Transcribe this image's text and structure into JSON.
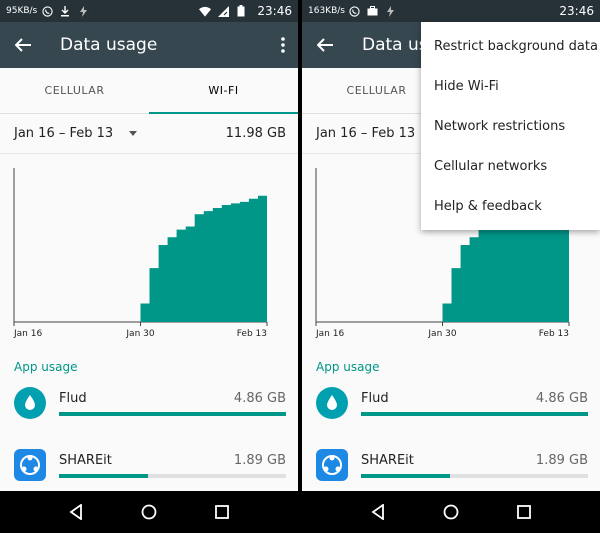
{
  "status_left": {
    "speed": "95KB/s",
    "time": "23:46"
  },
  "status_right": {
    "speed": "163KB/s",
    "time": "23:46"
  },
  "appbar": {
    "title": "Data usage"
  },
  "tabs": [
    {
      "label": "CELLULAR"
    },
    {
      "label": "WI-FI",
      "active": true
    }
  ],
  "cycle": {
    "range": "Jan 16 – Feb 13",
    "total": "11.98 GB"
  },
  "chart_data": {
    "type": "area",
    "x_ticks": [
      "Jan 16",
      "Jan 30",
      "Feb 13"
    ],
    "values": [
      0,
      0,
      0,
      0,
      0,
      0,
      0,
      0,
      0,
      0,
      0,
      0,
      0,
      0,
      0.12,
      0.35,
      0.5,
      0.55,
      0.6,
      0.62,
      0.7,
      0.72,
      0.74,
      0.76,
      0.77,
      0.78,
      0.8,
      0.82,
      0.85
    ],
    "ylim": [
      0,
      1
    ],
    "color": "#009688"
  },
  "section": {
    "label": "App usage"
  },
  "apps": [
    {
      "name": "Flud",
      "size": "4.86 GB",
      "fraction": 1.0,
      "icon": "flud-icon"
    },
    {
      "name": "SHAREit",
      "size": "1.89 GB",
      "fraction": 0.39,
      "icon": "shareit-icon"
    }
  ],
  "menu": {
    "items": [
      {
        "label": "Restrict background data"
      },
      {
        "label": "Hide Wi-Fi"
      },
      {
        "label": "Network restrictions"
      },
      {
        "label": "Cellular networks"
      },
      {
        "label": "Help & feedback"
      }
    ]
  },
  "colors": {
    "accent": "#009688",
    "appbar": "#37474f",
    "statusbar": "#263238"
  }
}
